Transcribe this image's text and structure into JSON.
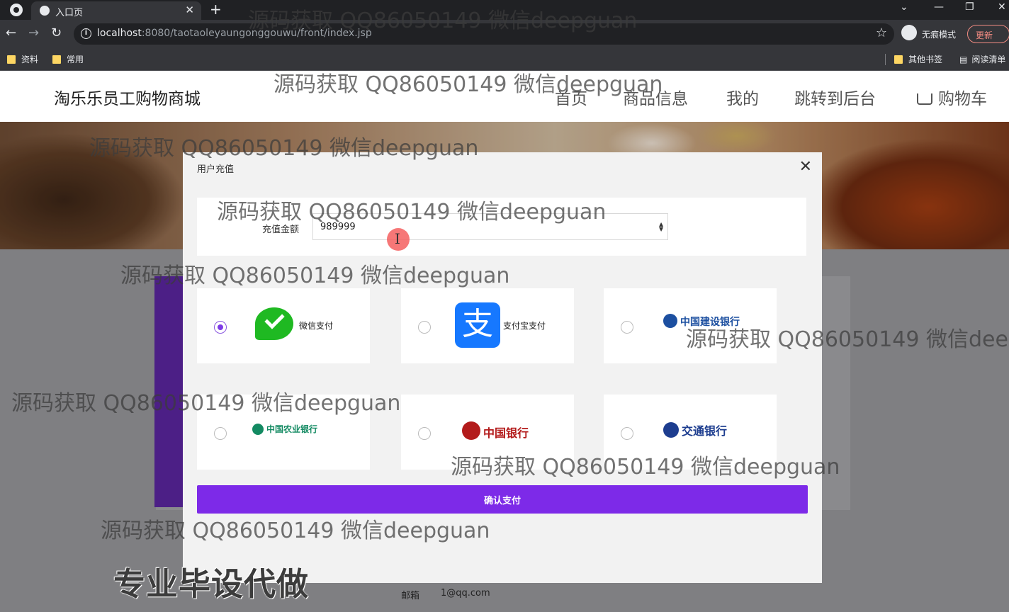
{
  "browser": {
    "tab_title": "入口页",
    "url_host": "localhost",
    "url_path": ":8080/taotaoleyaungonggouwu/front/index.jsp",
    "incognito_label": "无痕模式",
    "update_label": "更新",
    "bookmarks": [
      "资料",
      "常用"
    ],
    "other_bookmarks": "其他书签",
    "reading_list": "阅读清单"
  },
  "site": {
    "logo": "淘乐乐员工购物商城",
    "nav": [
      "首页",
      "商品信息",
      "我的",
      "跳转到后台",
      "购物车"
    ]
  },
  "modal": {
    "title": "用户充值",
    "amount_label": "充值金额",
    "amount_value": "989999",
    "payments": [
      {
        "name": "微信支付",
        "selected": true
      },
      {
        "name": "支付宝支付",
        "selected": false
      },
      {
        "name": "中国建设银行",
        "selected": false
      },
      {
        "name": "中国农业银行",
        "selected": false
      },
      {
        "name": "中国银行",
        "selected": false
      },
      {
        "name": "交通银行",
        "selected": false
      }
    ],
    "confirm_label": "确认支付"
  },
  "profile": {
    "email_label": "邮箱",
    "email_value": "1@qq.com"
  },
  "watermark": "源码获取 QQ86050149 微信deepguan",
  "promo": "专业毕设代做",
  "colors": {
    "accent": "#7d2ae8",
    "wechat": "#1fb922",
    "alipay": "#1678ff"
  }
}
